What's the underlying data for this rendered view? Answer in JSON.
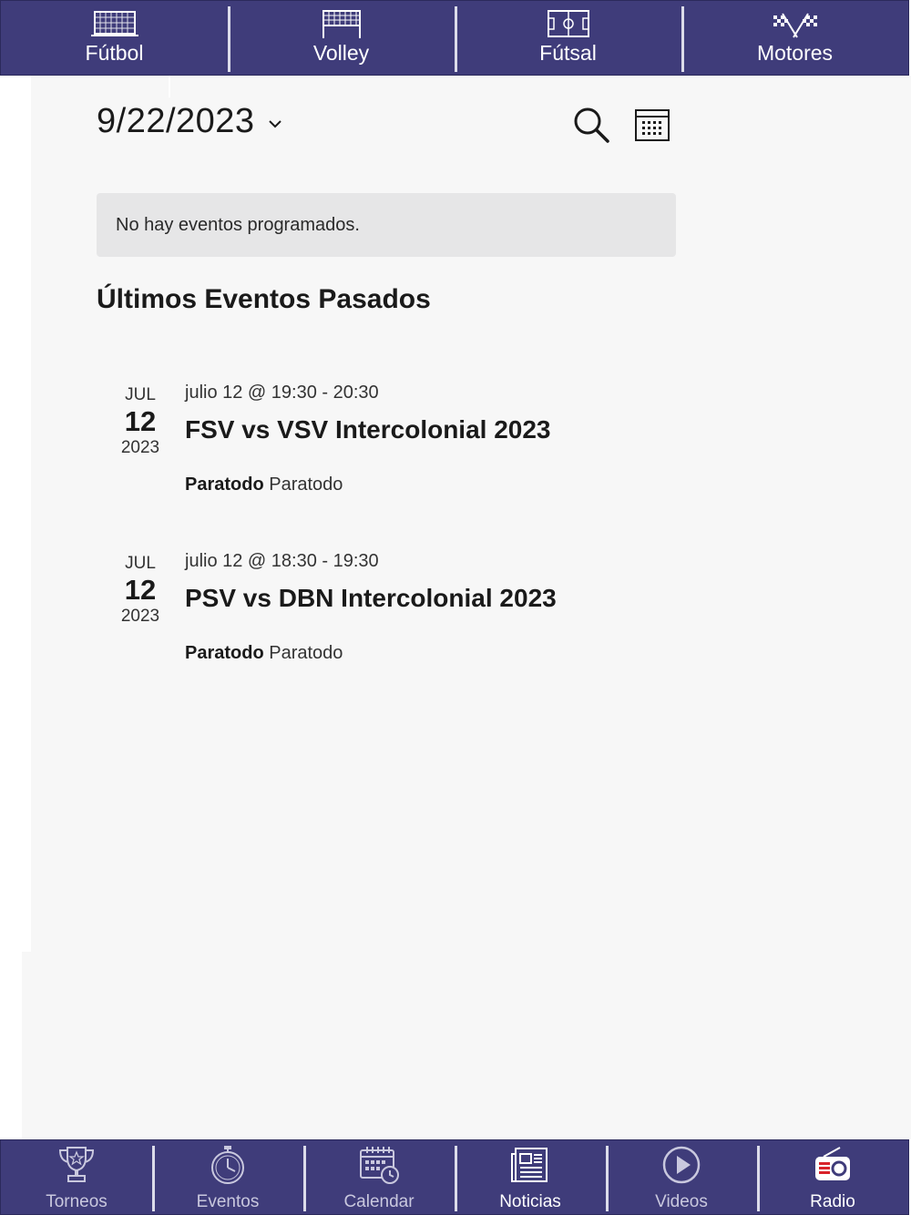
{
  "top_nav": {
    "items": [
      {
        "label": "Fútbol",
        "icon": "soccer-goal-icon"
      },
      {
        "label": "Volley",
        "icon": "volleyball-net-icon"
      },
      {
        "label": "Fútsal",
        "icon": "futsal-court-icon"
      },
      {
        "label": "Motores",
        "icon": "checkered-flags-icon"
      }
    ]
  },
  "date_picker": {
    "value": "9/22/2023"
  },
  "notice": {
    "text": "No hay eventos programados."
  },
  "past_events": {
    "title": "Últimos Eventos Pasados",
    "events": [
      {
        "month": "JUL",
        "day": "12",
        "year": "2023",
        "time": "julio 12 @ 19:30 - 20:30",
        "title": "FSV vs VSV Intercolonial 2023",
        "venue_label": "Paratodo",
        "venue": "Paratodo"
      },
      {
        "month": "JUL",
        "day": "12",
        "year": "2023",
        "time": "julio 12 @ 18:30 - 19:30",
        "title": "PSV vs DBN Intercolonial 2023",
        "venue_label": "Paratodo",
        "venue": "Paratodo"
      }
    ]
  },
  "bottom_nav": {
    "items": [
      {
        "label": "Torneos",
        "icon": "trophy-icon"
      },
      {
        "label": "Eventos",
        "icon": "stopwatch-icon"
      },
      {
        "label": "Calendar",
        "icon": "calendar-clock-icon"
      },
      {
        "label": "Noticias",
        "icon": "newspaper-icon",
        "active": true
      },
      {
        "label": "Videos",
        "icon": "play-icon"
      },
      {
        "label": "Radio",
        "icon": "radio-icon",
        "active": true
      }
    ]
  },
  "colors": {
    "nav_bg": "#3f3c7a",
    "page_bg": "#f7f7f7",
    "notice_bg": "#e6e6e7",
    "radio_accent": "#d8232a"
  }
}
